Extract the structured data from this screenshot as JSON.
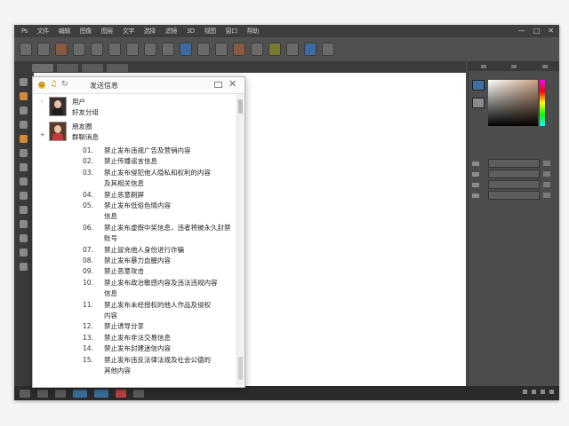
{
  "menubar": {
    "items": [
      "Ps",
      "文件",
      "编辑",
      "图像",
      "图层",
      "文字",
      "选择",
      "滤镜",
      "3D",
      "视图",
      "窗口",
      "帮助"
    ]
  },
  "window_controls": {
    "minimize": "—",
    "maximize": "□",
    "close": "✕"
  },
  "toolbar": {
    "icons": [
      "move-tool-icon",
      "marquee-tool-icon",
      "lasso-tool-icon",
      "crop-tool-icon",
      "eyedropper-icon",
      "brush-tool-icon",
      "stamp-tool-icon",
      "history-brush-icon",
      "eraser-icon",
      "gradient-icon",
      "blur-icon",
      "dodge-icon",
      "pen-tool-icon",
      "type-tool-icon",
      "path-select-icon",
      "shape-tool-icon",
      "hand-tool-icon",
      "zoom-tool-icon"
    ]
  },
  "dialog": {
    "title": "发送信息",
    "users": [
      {
        "name": "用户",
        "subname": "好友分组"
      },
      {
        "name": "朋友圈",
        "subname": "群聊消息"
      }
    ],
    "rules": [
      {
        "num": "01.",
        "text": "禁止发布违规广告及营销内容"
      },
      {
        "num": "02.",
        "text": "禁止传播谣言信息"
      },
      {
        "num": "03.",
        "text": "禁止发布侵犯他人隐私和权利的内容"
      },
      {
        "num": "",
        "text": "及其相关信息"
      },
      {
        "num": "04.",
        "text": "禁止恶意刷屏"
      },
      {
        "num": "05.",
        "text": "禁止发布低俗色情内容"
      },
      {
        "num": "",
        "text": "信息"
      },
      {
        "num": "06.",
        "text": "禁止发布虚假中奖信息，违者将被永久封禁"
      },
      {
        "num": "",
        "text": "账号"
      },
      {
        "num": "07.",
        "text": "禁止冒充他人身份进行诈骗"
      },
      {
        "num": "08.",
        "text": "禁止发布暴力血腥内容"
      },
      {
        "num": "09.",
        "text": "禁止恶意攻击"
      },
      {
        "num": "10.",
        "text": "禁止发布政治敏感内容及违法违规内容"
      },
      {
        "num": "",
        "text": "信息"
      },
      {
        "num": "11.",
        "text": "禁止发布未经授权的他人作品及侵权"
      },
      {
        "num": "",
        "text": "内容"
      },
      {
        "num": "12.",
        "text": "禁止诱导分享"
      },
      {
        "num": "13.",
        "text": "禁止发布非法交易信息"
      },
      {
        "num": "14.",
        "text": "禁止发布封建迷信内容"
      },
      {
        "num": "15.",
        "text": "禁止发布违反法律法规及社会公德的"
      },
      {
        "num": "",
        "text": "其他内容"
      }
    ]
  },
  "colors": {
    "app_bg": "#4a4a4a",
    "canvas": "#ffffff",
    "accent": "#3a6e9e"
  }
}
